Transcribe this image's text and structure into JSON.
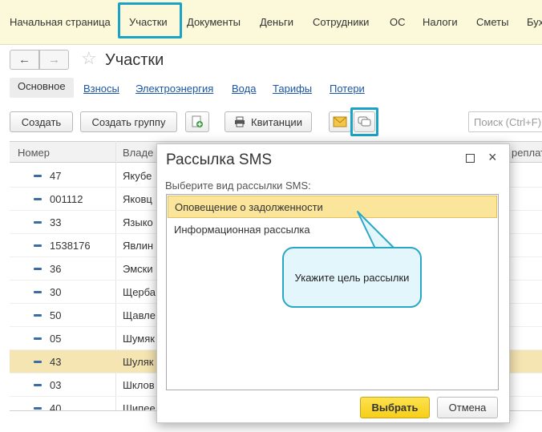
{
  "top_menu": {
    "items": [
      "Начальная страница",
      "Участки",
      "Документы",
      "Деньги",
      "Сотрудники",
      "ОС",
      "Налоги",
      "Сметы",
      "Бух"
    ]
  },
  "header": {
    "back_icon": "arrow-left-icon",
    "forward_icon": "arrow-right-icon",
    "star_icon": "star-icon",
    "title": "Участки"
  },
  "subtabs": [
    "Основное",
    "Взносы",
    "Электроэнергия",
    "Вода",
    "Тарифы",
    "Потери"
  ],
  "toolbar": {
    "create_label": "Создать",
    "create_group_label": "Создать группу",
    "receipts_label": "Квитанции",
    "search_placeholder": "Поиск (Ctrl+F)"
  },
  "table": {
    "columns": [
      "Номер",
      "Владе",
      "реплат"
    ],
    "rows": [
      {
        "num": "47",
        "owner": "Якубе"
      },
      {
        "num": "001112",
        "owner": "Яковц"
      },
      {
        "num": "33",
        "owner": "Языко"
      },
      {
        "num": "1538176",
        "owner": "Явлин"
      },
      {
        "num": "36",
        "owner": "Эмски"
      },
      {
        "num": "30",
        "owner": "Щерба"
      },
      {
        "num": "50",
        "owner": "Щавле"
      },
      {
        "num": "05",
        "owner": "Шумяк"
      },
      {
        "num": "43",
        "owner": "Шуляк",
        "selected": true
      },
      {
        "num": "03",
        "owner": "Шклов"
      },
      {
        "num": "40",
        "owner": "Шипее"
      }
    ]
  },
  "dialog": {
    "title": "Рассылка SMS",
    "prompt": "Выберите вид рассылки SMS:",
    "options": [
      "Оповещение о задолженности",
      "Информационная рассылка"
    ],
    "select_label": "Выбрать",
    "cancel_label": "Отмена",
    "close_glyph": "×"
  },
  "tooltip": {
    "text": "Укажите цель рассылки"
  },
  "colors": {
    "menu_bg": "#fbf9d9",
    "highlight": "#1aa3c4",
    "selection": "#f5e5b2",
    "primary_button": "#f6cf18",
    "tooltip_bg": "#e3f6fb"
  }
}
